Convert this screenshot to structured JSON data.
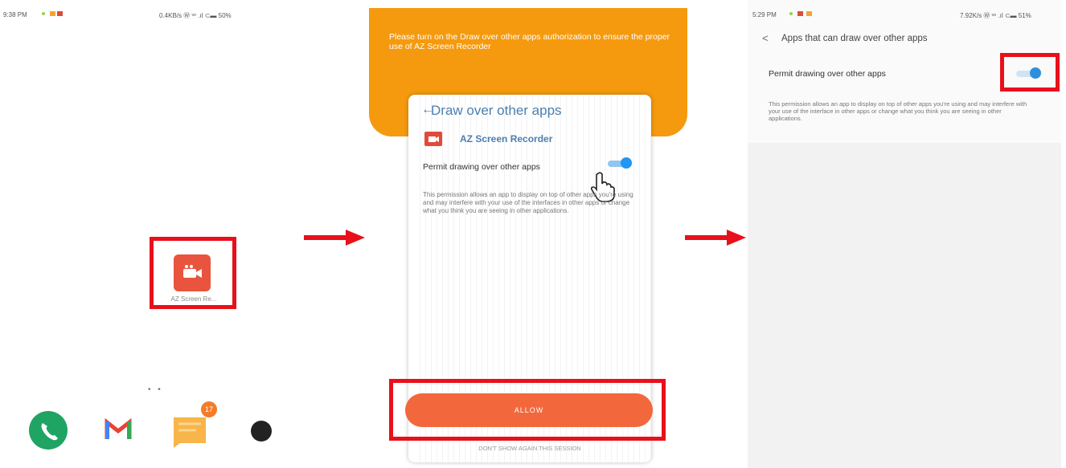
{
  "panel1": {
    "status_time": "9:38 PM",
    "status_right": "0.4KB/s  Ⓦ  ᵛᵒ  .ıl  ⊂▬ 50%",
    "app_label": "AZ Screen Re...",
    "page_dots": "• •",
    "dock": [
      {
        "name": "phone-app",
        "color": "#1fa463"
      },
      {
        "name": "gmail-app",
        "color": "#ea4335"
      },
      {
        "name": "messages-app",
        "color": "#f7b54a",
        "badge": "17"
      },
      {
        "name": "camera-app",
        "color": "#222222"
      }
    ]
  },
  "panel2": {
    "banner": "Please turn on the Draw over other apps authorization to ensure the proper use of AZ Screen Recorder",
    "card_title": "Draw over other apps",
    "app_name": "AZ Screen Recorder",
    "permit_label": "Permit drawing over other apps",
    "description": "This permission allows an app to display on top of other apps you're using and may interfere with your use of the interfaces in other apps or change what you think you are seeing in other applications.",
    "allow_button": "ALLOW",
    "dont_show": "DON'T SHOW AGAIN THIS SESSION",
    "toggle_on": true
  },
  "panel3": {
    "status_time": "5:29 PM",
    "status_right": "7.92K/s  Ⓦ  ᵛᵒ  .ıl  ⊂▬ 51%",
    "title": "Apps that can draw over other apps",
    "permit_label": "Permit drawing over other apps",
    "description": "This permission allows an app to display on top of other apps you're using and may interfere with your use of the interface in other apps or change what you think you are seeing in other applications.",
    "toggle_on": true
  },
  "colors": {
    "highlight": "#e8101a",
    "banner": "#f59a0e",
    "allow": "#f2683c",
    "toggle": "#2196f3"
  }
}
